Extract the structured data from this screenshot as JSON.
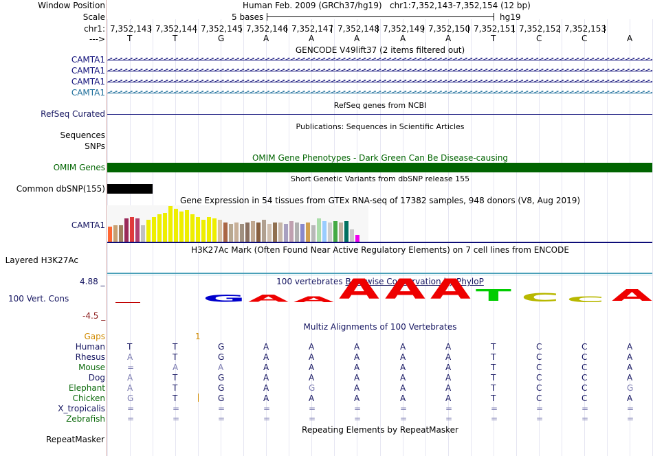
{
  "header": {
    "window_position_label": "Window Position",
    "scale_label": "Scale",
    "chr_label": "chr1:",
    "strand_label": "--->",
    "assembly": "Human Feb. 2009 (GRCh37/hg19)",
    "position": "chr1:7,352,143-7,352,154 (12 bp)",
    "scale_text": "5 bases",
    "scale_db": "hg19",
    "coords": [
      "7,352,143",
      "7,352,144",
      "7,352,145",
      "7,352,146",
      "7,352,147",
      "7,352,148",
      "7,352,149",
      "7,352,150",
      "7,352,151",
      "7,352,152",
      "7,352,153"
    ],
    "bases": [
      "T",
      "T",
      "G",
      "A",
      "A",
      "A",
      "A",
      "A",
      "T",
      "C",
      "C",
      "A"
    ]
  },
  "tracks": {
    "gencode": {
      "title": "GENCODE V49lift37 (2 items filtered out)",
      "genes": [
        "CAMTA1",
        "CAMTA1",
        "CAMTA1",
        "CAMTA1"
      ],
      "colors": [
        "#0c0c78",
        "#0c0c78",
        "#0c0c78",
        "#1b6d9a"
      ]
    },
    "refseq": {
      "label": "RefSeq Curated",
      "title": "RefSeq genes from NCBI"
    },
    "publications": {
      "title": "Publications: Sequences in Scientific Articles",
      "labels": [
        "Sequences",
        "SNPs"
      ]
    },
    "omim": {
      "title": "OMIM Gene Phenotypes - Dark Green Can Be Disease-causing",
      "label": "OMIM Genes",
      "color": "#006400"
    },
    "dbsnp": {
      "title": "Short Genetic Variants from dbSNP release 155",
      "label": "Common dbSNP(155)"
    },
    "gtex": {
      "title": "Gene Expression in 54 tissues from GTEx RNA-seq of 17382 samples, 948 donors (V8, Aug 2019)",
      "label": "CAMTA1"
    },
    "h3k27ac": {
      "title": "H3K27Ac Mark (Often Found Near Active Regulatory Elements) on 7 cell lines from ENCODE",
      "label": "Layered H3K27Ac"
    },
    "conservation": {
      "title_prefix": "100 vertebrates",
      "title_link": "Basewise Conservation by PhyloP",
      "label": "100 Vert. Cons",
      "max": "4.88 _",
      "min": "-4.5 _"
    },
    "multiz": {
      "title": "Multiz Alignments of 100 Vertebrates",
      "gaps_label": "Gaps",
      "gap_mark": "1",
      "species": [
        "Human",
        "Rhesus",
        "Mouse",
        "Dog",
        "Elephant",
        "Chicken",
        "X_tropicalis",
        "Zebrafish"
      ],
      "rows": [
        [
          "T",
          "T",
          "G",
          "A",
          "A",
          "A",
          "A",
          "A",
          "T",
          "C",
          "C",
          "A"
        ],
        [
          "A",
          "T",
          "G",
          "A",
          "A",
          "A",
          "A",
          "A",
          "T",
          "C",
          "C",
          "A"
        ],
        [
          "=",
          "A",
          "A",
          "A",
          "A",
          "A",
          "A",
          "A",
          "T",
          "C",
          "C",
          "A"
        ],
        [
          "A",
          "T",
          "G",
          "A",
          "A",
          "A",
          "A",
          "A",
          "T",
          "C",
          "C",
          "A"
        ],
        [
          "A",
          "T",
          "G",
          "A",
          "G",
          "A",
          "A",
          "A",
          "T",
          "C",
          "C",
          "G"
        ],
        [
          "G",
          "T",
          "G",
          "A",
          "A",
          "A",
          "A",
          "A",
          "T",
          "C",
          "C",
          "A"
        ],
        [
          "=",
          "=",
          "=",
          "=",
          "=",
          "=",
          "=",
          "=",
          "=",
          "=",
          "=",
          "="
        ],
        [
          "=",
          "=",
          "=",
          "=",
          "=",
          "=",
          "=",
          "=",
          "=",
          "=",
          "=",
          "="
        ]
      ]
    },
    "repeatmasker": {
      "title": "Repeating Elements by RepeatMasker",
      "label": "RepeatMasker"
    }
  }
}
